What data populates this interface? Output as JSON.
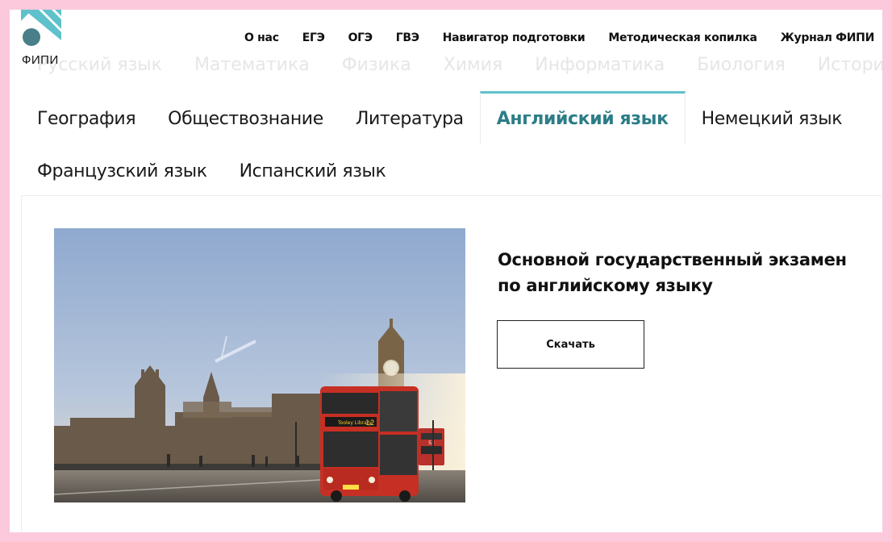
{
  "brand": {
    "logo_text": "ФИПИ",
    "colors": {
      "teal": "#5fc1cc",
      "teal_dark": "#3c8e98",
      "circle": "#4a7f8a"
    }
  },
  "top_nav": [
    "О нас",
    "ЕГЭ",
    "ОГЭ",
    "ГВЭ",
    "Навигатор подготовки",
    "Методическая копилка",
    "Журнал ФИПИ"
  ],
  "faded_subjects": [
    "Русский язык",
    "Математика",
    "Физика",
    "Химия",
    "Информатика",
    "Биология",
    "История"
  ],
  "subject_tabs": {
    "row1": [
      "География",
      "Обществознание",
      "Литература",
      "Английский язык",
      "Немецкий язык"
    ],
    "row2": [
      "Французский язык",
      "Испанский язык"
    ],
    "active": "Английский язык"
  },
  "card": {
    "title_line1": "Основной государственный экзамен",
    "title_line2": "по английскому языку",
    "download_label": "Скачать"
  },
  "photo": {
    "icon": "london-westminster-bus-photo",
    "bus_sign": "Tooley Library",
    "bus_number": "12",
    "second_bus_number": "53"
  }
}
